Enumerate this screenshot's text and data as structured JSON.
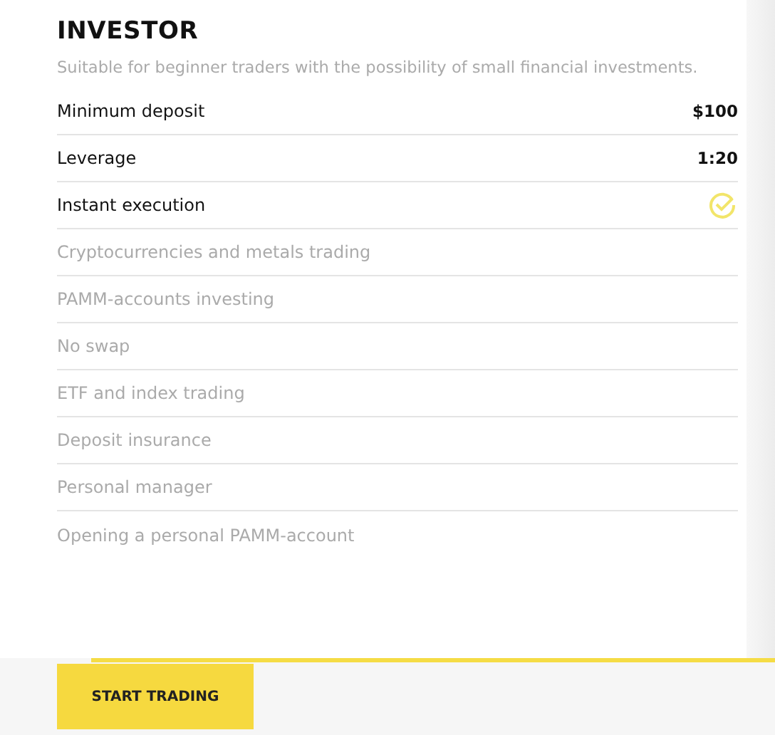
{
  "plan": {
    "title": "INVESTOR",
    "description": "Suitable for beginner traders with the possibility of small financial investments."
  },
  "features": [
    {
      "label": "Minimum deposit",
      "available": true,
      "kind": "text",
      "value": "$100"
    },
    {
      "label": "Leverage",
      "available": true,
      "kind": "text",
      "value": "1:20"
    },
    {
      "label": "Instant execution",
      "available": true,
      "kind": "check"
    },
    {
      "label": "Cryptocurrencies and metals trading",
      "available": false,
      "kind": "none"
    },
    {
      "label": "PAMM-accounts investing",
      "available": false,
      "kind": "none"
    },
    {
      "label": "No swap",
      "available": false,
      "kind": "none"
    },
    {
      "label": "ETF and index trading",
      "available": false,
      "kind": "none"
    },
    {
      "label": "Deposit insurance",
      "available": false,
      "kind": "none"
    },
    {
      "label": "Personal manager",
      "available": false,
      "kind": "none"
    },
    {
      "label": "Opening a personal PAMM-account",
      "available": false,
      "kind": "none"
    }
  ],
  "button": {
    "label": "START TRADING"
  }
}
